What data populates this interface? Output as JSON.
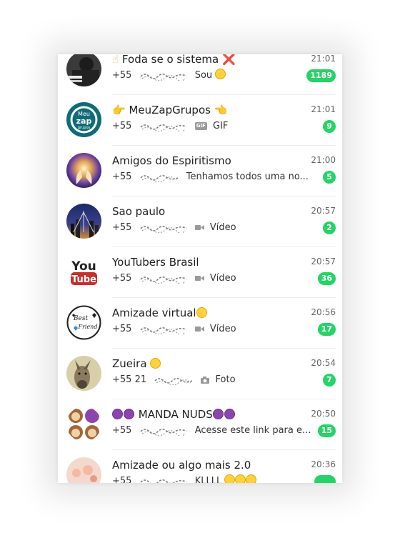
{
  "chats": [
    {
      "name": "Foda se o sistema",
      "name_prefix_icon": "hand-icon",
      "name_suffix": "❌",
      "time": "21:01",
      "sender": "+55",
      "preview": "Sou",
      "preview_suffix_icon": "halo-smile-emoji",
      "unread": "1189",
      "avatar": "dark-photo"
    },
    {
      "name": "MeuZapGrupos",
      "name_prefix_icon": "pointing-right-icon",
      "name_suffix_icon": "pointing-left-icon",
      "time": "21:01",
      "sender": "+55",
      "media_icon": "gif-icon",
      "media_label": "GIF",
      "preview": "GIF",
      "unread": "9",
      "avatar": "meuzap-logo",
      "avatar_text": [
        "Meu",
        "zap",
        "grupos"
      ]
    },
    {
      "name": "Amigos do Espiritismo",
      "time": "21:00",
      "sender": "+55",
      "preview": "Tenhamos todos uma no...",
      "unread": "5",
      "avatar": "glowing-hands"
    },
    {
      "name": "Sao paulo",
      "time": "20:57",
      "sender": "+55",
      "media_icon": "video-icon",
      "preview": "Vídeo",
      "unread": "2",
      "avatar": "city-night"
    },
    {
      "name": "YouTubers Brasil",
      "time": "20:57",
      "sender": "+55",
      "media_icon": "video-icon",
      "preview": "Vídeo",
      "unread": "36",
      "avatar": "youtube-logo",
      "avatar_text": [
        "You",
        "Tube"
      ]
    },
    {
      "name": "Amizade virtual",
      "name_suffix_icon": "smile-emoji",
      "time": "20:56",
      "sender": "+55",
      "media_icon": "video-icon",
      "preview": "Vídeo",
      "unread": "17",
      "avatar": "best-friend",
      "avatar_text": [
        "Best",
        "Friend"
      ]
    },
    {
      "name": "Zueira",
      "name_suffix_icon": "laughing-emoji",
      "time": "20:54",
      "sender": "+55 21",
      "media_icon": "camera-icon",
      "preview": "Foto",
      "unread": "7",
      "avatar": "donkey-photo"
    },
    {
      "name": "MANDA NUDS",
      "name_prefix_icon": "devil-emojis",
      "name_suffix_icon": "devil-emojis",
      "time": "20:50",
      "sender": "+55",
      "preview": "Acesse este link para e...",
      "unread": "15",
      "avatar": "monkeys-emoji"
    },
    {
      "name": "Amizade ou algo mais 2.0",
      "time": "20:36",
      "sender": "+55",
      "preview": "KLLLL",
      "preview_suffix_icon": "smile-emojis",
      "unread": "",
      "avatar": "pink-photo"
    }
  ]
}
